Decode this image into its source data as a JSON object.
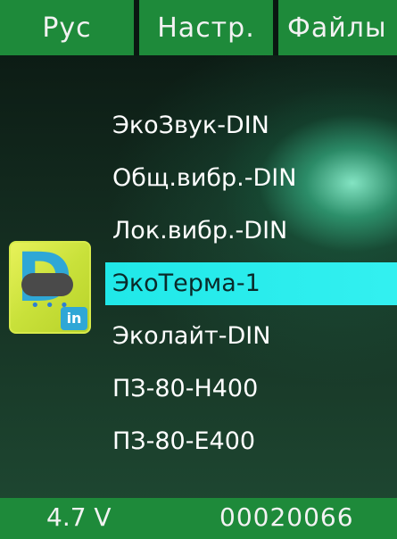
{
  "menu": {
    "tabs": [
      {
        "label": "Рус"
      },
      {
        "label": "Настр."
      },
      {
        "label": "Файлы"
      }
    ]
  },
  "devices": {
    "items": [
      {
        "label": "ЭкоЗвук-DIN",
        "selected": false
      },
      {
        "label": "Общ.вибр.-DIN",
        "selected": false
      },
      {
        "label": "Лок.вибр.-DIN",
        "selected": false
      },
      {
        "label": "ЭкоТерма-1",
        "selected": true
      },
      {
        "label": "Эколайт-DIN",
        "selected": false
      },
      {
        "label": "ПЗ-80-Н400",
        "selected": false
      },
      {
        "label": "ПЗ-80-Е400",
        "selected": false
      }
    ]
  },
  "app_icon": {
    "letter": "D",
    "sub": "in",
    "icon": "weather-cloud-rain-icon"
  },
  "status": {
    "voltage": "4.7 V",
    "serial": "00020066"
  },
  "colors": {
    "bar_green": "#1e8a3a",
    "selection_cyan": "#33f0f0",
    "text_white": "#ffffff"
  }
}
